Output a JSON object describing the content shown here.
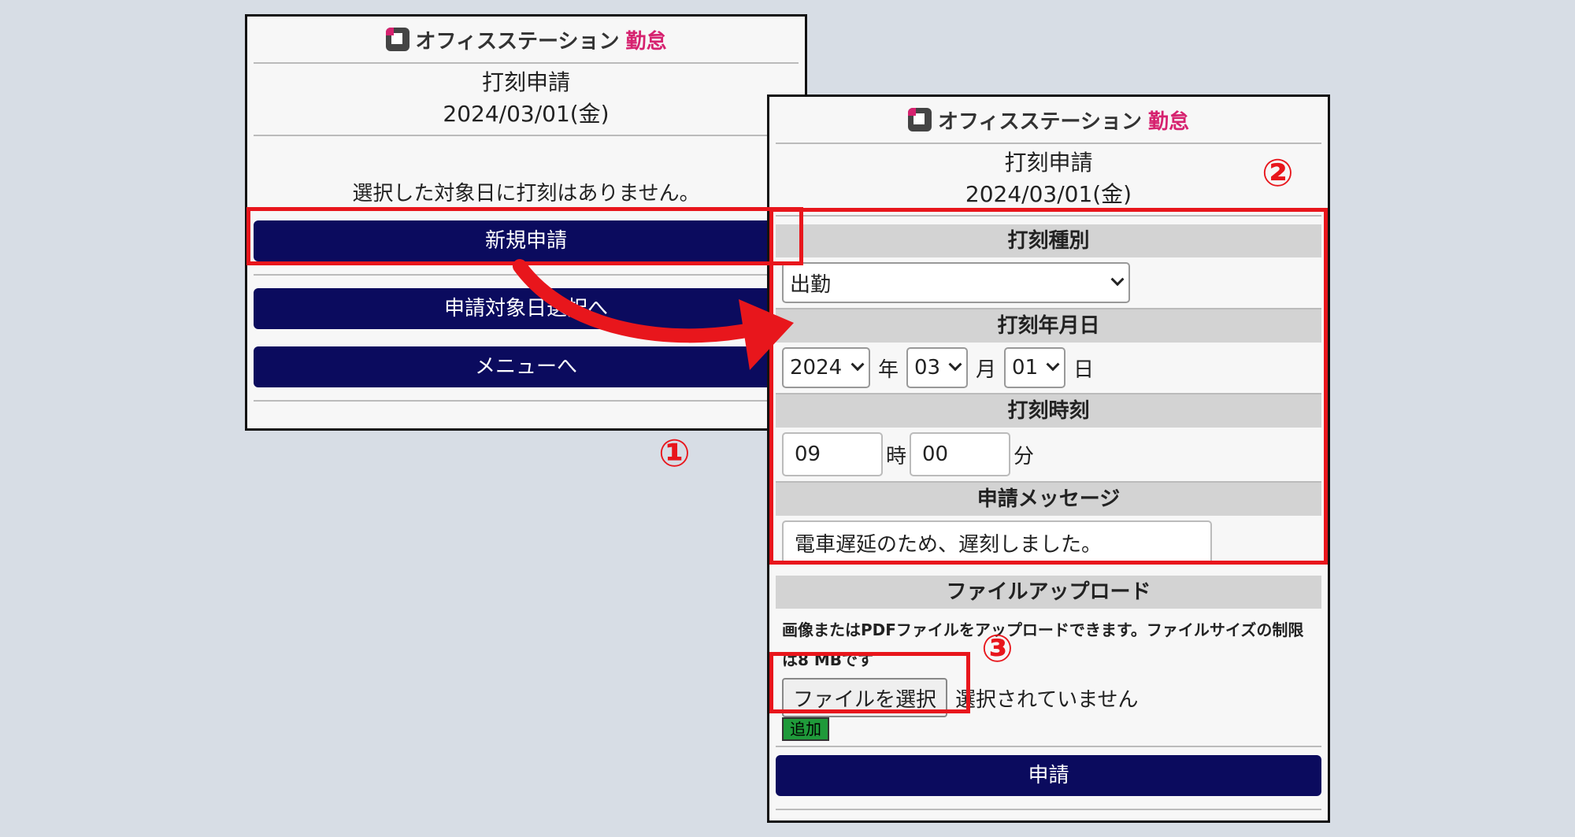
{
  "brand": {
    "name": "オフィスステーション",
    "accent": "勤怠"
  },
  "screen1": {
    "title": "打刻申請",
    "date": "2024/03/01(金)",
    "message": "選択した対象日に打刻はありません。",
    "new_button": "新規申請",
    "select_date_button": "申請対象日選択へ",
    "menu_button": "メニューへ"
  },
  "screen2": {
    "title": "打刻申請",
    "date": "2024/03/01(金)",
    "type_header": "打刻種別",
    "type_value": "出勤",
    "date_header": "打刻年月日",
    "year": "2024",
    "year_unit": "年",
    "month": "03",
    "month_unit": "月",
    "day": "01",
    "day_unit": "日",
    "time_header": "打刻時刻",
    "hour": "09",
    "hour_unit": "時",
    "minute": "00",
    "minute_unit": "分",
    "message_header": "申請メッセージ",
    "message_value": "電車遅延のため、遅刻しました。",
    "upload_header": "ファイルアップロード",
    "upload_note": "画像またはPDFファイルをアップロードできます。ファイルサイズの制限は8 MBです",
    "file_button": "ファイルを選択",
    "file_status": "選択されていません",
    "add_button": "追加",
    "submit_button": "申請"
  },
  "annotations": {
    "step1": "①",
    "step2": "②",
    "step3": "③"
  },
  "colors": {
    "navy": "#0b0b5e",
    "annotation_red": "#e8161c",
    "brand_pink": "#d6226f",
    "add_green": "#1f9a3a"
  }
}
